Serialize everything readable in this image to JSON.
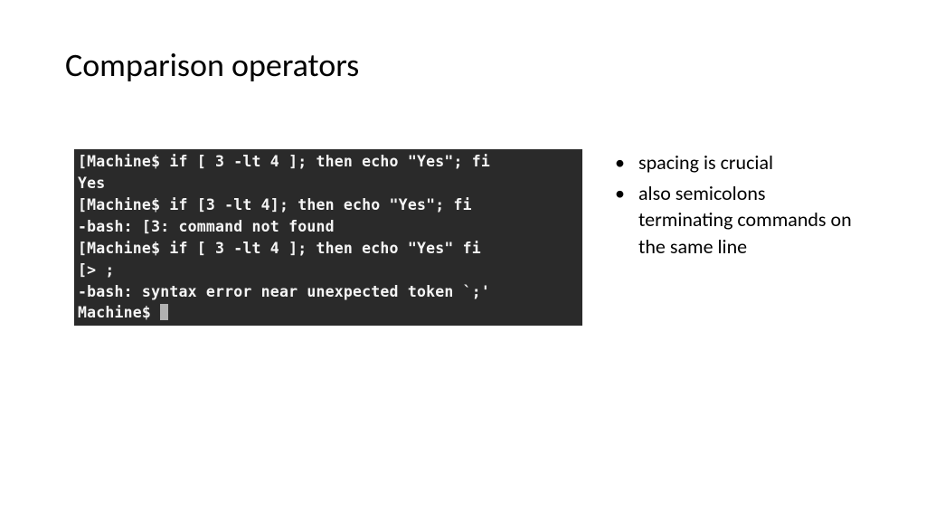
{
  "title": "Comparison operators",
  "terminal": {
    "line1": "[Machine$ if [ 3 -lt 4 ]; then echo \"Yes\"; fi",
    "line2": "Yes",
    "line3": "[Machine$ if [3 -lt 4]; then echo \"Yes\"; fi",
    "line4": "-bash: [3: command not found",
    "line5": "[Machine$ if [ 3 -lt 4 ]; then echo \"Yes\" fi",
    "line6": "[> ;",
    "line7": "-bash: syntax error near unexpected token `;'",
    "line8": "Machine$ "
  },
  "bullets": {
    "item1": "spacing is crucial",
    "item2": "also semicolons terminating commands on the same line"
  }
}
